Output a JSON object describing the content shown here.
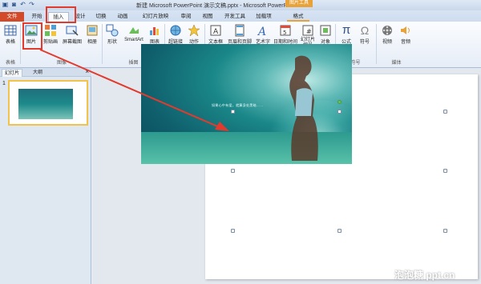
{
  "title_bar": {
    "title": "新建 Microsoft PowerPoint 演示文稿.pptx - Microsoft PowerPoint",
    "contextual_header": "图片工具"
  },
  "tabs": [
    "文件",
    "开始",
    "插入",
    "设计",
    "切换",
    "动画",
    "幻灯片放映",
    "审阅",
    "视图",
    "开发工具",
    "加载项",
    "格式"
  ],
  "ribbon": {
    "groups": [
      {
        "label": "表格",
        "buttons": [
          "表格"
        ]
      },
      {
        "label": "图像",
        "buttons": [
          "图片",
          "剪贴画",
          "屏幕截图",
          "相册"
        ]
      },
      {
        "label": "插图",
        "buttons": [
          "形状",
          "SmartArt",
          "图表"
        ]
      },
      {
        "label": "链接",
        "buttons": [
          "超链接",
          "动作"
        ]
      },
      {
        "label": "文本",
        "buttons": [
          "文本框",
          "页眉和页脚",
          "艺术字",
          "日期和时间",
          "幻灯片编号",
          "对象"
        ]
      },
      {
        "label": "符号",
        "buttons": [
          "公式",
          "符号"
        ]
      },
      {
        "label": "媒体",
        "buttons": [
          "视频",
          "音频"
        ]
      }
    ]
  },
  "left_panel": {
    "tabs": [
      "幻灯片",
      "大纲"
    ],
    "close": "×",
    "slide_number": "1"
  },
  "slide": {
    "caption": "如果心中有爱，就算身处黑暗……"
  },
  "watermark": "泡泡糖 ppt.cn",
  "colors": {
    "file_tab": "#d24a29",
    "contextual": "#e8a23a",
    "highlight": "#e23b2e"
  }
}
